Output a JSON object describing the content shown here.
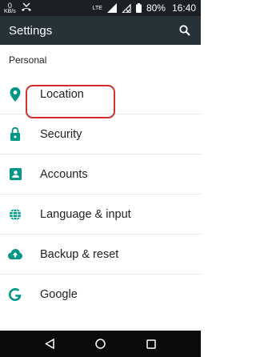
{
  "status_bar": {
    "net_speed_value": "0",
    "net_speed_unit": "KB/s",
    "network_type": "LTE",
    "battery_percent": "80%",
    "time": "16:40"
  },
  "app_bar": {
    "title": "Settings",
    "search_icon": "search-icon"
  },
  "section": {
    "title": "Personal"
  },
  "items": [
    {
      "label": "Location",
      "icon": "location-icon"
    },
    {
      "label": "Security",
      "icon": "lock-icon"
    },
    {
      "label": "Accounts",
      "icon": "account-box-icon"
    },
    {
      "label": "Language & input",
      "icon": "globe-icon"
    },
    {
      "label": "Backup & reset",
      "icon": "cloud-upload-icon"
    },
    {
      "label": "Google",
      "icon": "google-icon"
    }
  ],
  "colors": {
    "accent": "#009688",
    "status_bar": "#1a2024",
    "app_bar": "#263238",
    "highlight": "#d32f2f"
  },
  "nav_bar": {
    "back_icon": "back-icon",
    "home_icon": "home-icon",
    "recents_icon": "recents-icon"
  }
}
